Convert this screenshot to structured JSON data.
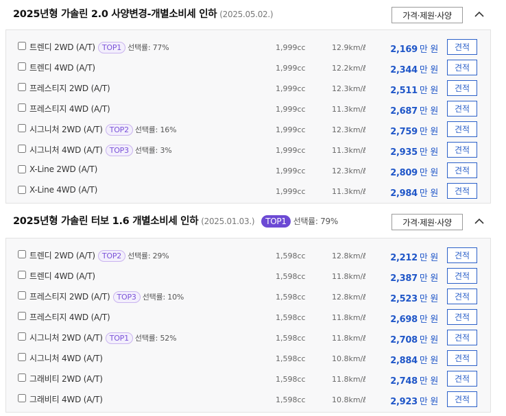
{
  "sections": [
    {
      "title": "2025년형 가솔린 2.0 사양변경-개별소비세 인하",
      "date": "(2025.05.02.)",
      "top_badge": "",
      "top_rate": "",
      "spec_button": "가격·제원·사양",
      "rows": [
        {
          "trim": "트렌디 2WD (A/T)",
          "badge": "TOP1",
          "rate": "선택률: 77%",
          "cc": "1,999cc",
          "efficiency": "12.9km/ℓ",
          "price": "2,169",
          "unit": "만 원",
          "quote": "견적"
        },
        {
          "trim": "트렌디 4WD (A/T)",
          "badge": "",
          "rate": "",
          "cc": "1,999cc",
          "efficiency": "12.2km/ℓ",
          "price": "2,344",
          "unit": "만 원",
          "quote": "견적"
        },
        {
          "trim": "프레스티지 2WD (A/T)",
          "badge": "",
          "rate": "",
          "cc": "1,999cc",
          "efficiency": "12.3km/ℓ",
          "price": "2,511",
          "unit": "만 원",
          "quote": "견적"
        },
        {
          "trim": "프레스티지 4WD (A/T)",
          "badge": "",
          "rate": "",
          "cc": "1,999cc",
          "efficiency": "11.3km/ℓ",
          "price": "2,687",
          "unit": "만 원",
          "quote": "견적"
        },
        {
          "trim": "시그니처 2WD (A/T)",
          "badge": "TOP2",
          "rate": "선택률: 16%",
          "cc": "1,999cc",
          "efficiency": "12.3km/ℓ",
          "price": "2,759",
          "unit": "만 원",
          "quote": "견적"
        },
        {
          "trim": "시그니처 4WD (A/T)",
          "badge": "TOP3",
          "rate": "선택률: 3%",
          "cc": "1,999cc",
          "efficiency": "11.3km/ℓ",
          "price": "2,935",
          "unit": "만 원",
          "quote": "견적"
        },
        {
          "trim": "X-Line 2WD (A/T)",
          "badge": "",
          "rate": "",
          "cc": "1,999cc",
          "efficiency": "12.3km/ℓ",
          "price": "2,809",
          "unit": "만 원",
          "quote": "견적"
        },
        {
          "trim": "X-Line 4WD (A/T)",
          "badge": "",
          "rate": "",
          "cc": "1,999cc",
          "efficiency": "11.3km/ℓ",
          "price": "2,984",
          "unit": "만 원",
          "quote": "견적"
        }
      ]
    },
    {
      "title": "2025년형 가솔린 터보 1.6 개별소비세 인하",
      "date": "(2025.01.03.)",
      "top_badge": "TOP1",
      "top_rate": "선택률: 79%",
      "spec_button": "가격·제원·사양",
      "rows": [
        {
          "trim": "트렌디 2WD (A/T)",
          "badge": "TOP2",
          "rate": "선택률: 29%",
          "cc": "1,598cc",
          "efficiency": "12.8km/ℓ",
          "price": "2,212",
          "unit": "만 원",
          "quote": "견적"
        },
        {
          "trim": "트렌디 4WD (A/T)",
          "badge": "",
          "rate": "",
          "cc": "1,598cc",
          "efficiency": "11.8km/ℓ",
          "price": "2,387",
          "unit": "만 원",
          "quote": "견적"
        },
        {
          "trim": "프레스티지 2WD (A/T)",
          "badge": "TOP3",
          "rate": "선택률: 10%",
          "cc": "1,598cc",
          "efficiency": "12.8km/ℓ",
          "price": "2,523",
          "unit": "만 원",
          "quote": "견적"
        },
        {
          "trim": "프레스티지 4WD (A/T)",
          "badge": "",
          "rate": "",
          "cc": "1,598cc",
          "efficiency": "11.8km/ℓ",
          "price": "2,698",
          "unit": "만 원",
          "quote": "견적"
        },
        {
          "trim": "시그니처 2WD (A/T)",
          "badge": "TOP1",
          "rate": "선택률: 52%",
          "cc": "1,598cc",
          "efficiency": "11.8km/ℓ",
          "price": "2,708",
          "unit": "만 원",
          "quote": "견적"
        },
        {
          "trim": "시그니처 4WD (A/T)",
          "badge": "",
          "rate": "",
          "cc": "1,598cc",
          "efficiency": "10.8km/ℓ",
          "price": "2,884",
          "unit": "만 원",
          "quote": "견적"
        },
        {
          "trim": "그래비티 2WD (A/T)",
          "badge": "",
          "rate": "",
          "cc": "1,598cc",
          "efficiency": "11.8km/ℓ",
          "price": "2,748",
          "unit": "만 원",
          "quote": "견적"
        },
        {
          "trim": "그래비티 4WD (A/T)",
          "badge": "",
          "rate": "",
          "cc": "1,598cc",
          "efficiency": "10.8km/ℓ",
          "price": "2,923",
          "unit": "만 원",
          "quote": "견적"
        }
      ]
    }
  ],
  "colors": {
    "price": "#1f56c8",
    "top_badge_header": "#6c4ad4",
    "top_badge_row": "#7a52d8"
  },
  "icons": {
    "collapse": "chevron-up-icon"
  }
}
